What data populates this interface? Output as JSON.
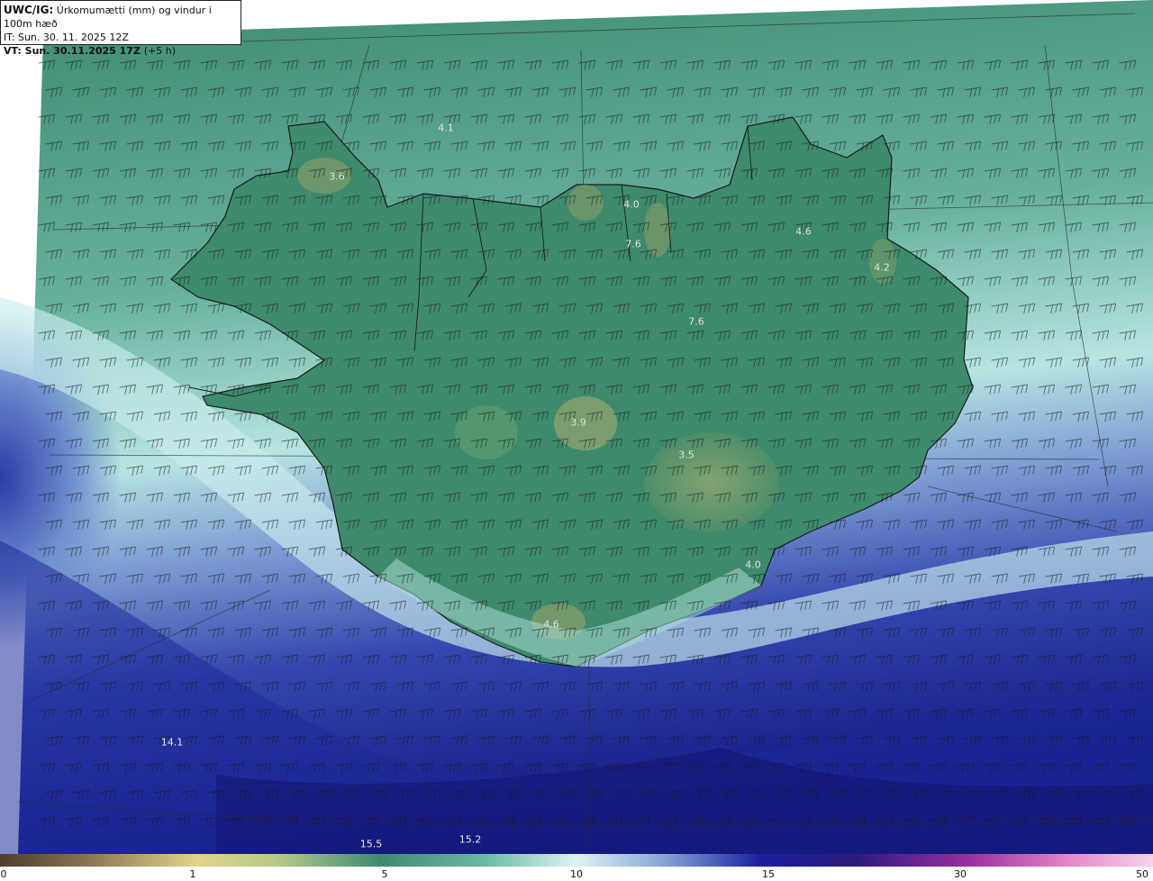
{
  "header": {
    "model": "UWC/IG:",
    "title": "Úrkomumætti (mm) og vindur i 100m hæð",
    "init_time": "IT: Sun. 30. 11. 2025 12Z",
    "valid_time": "VT: Sun. 30.11.2025 17Z",
    "lead": "(+5 h)"
  },
  "map_labels": [
    {
      "text": "4.1"
    },
    {
      "text": "3.6"
    },
    {
      "text": "4.0"
    },
    {
      "text": "7.6"
    },
    {
      "text": "4.6"
    },
    {
      "text": "4.2"
    },
    {
      "text": "7.6"
    },
    {
      "text": "3.9"
    },
    {
      "text": "3.5"
    },
    {
      "text": "4.0"
    },
    {
      "text": "4.6"
    },
    {
      "text": "14.1"
    },
    {
      "text": "15.5"
    },
    {
      "text": "15.2"
    }
  ],
  "colorbar": {
    "ticks": [
      "0",
      "1",
      "5",
      "10",
      "15",
      "30",
      "50"
    ],
    "colors": [
      "#5b4a3a",
      "#a48b5e",
      "#e0d48a",
      "#6ba37e",
      "#3f8a72",
      "#cfeff0",
      "#7b9bd0",
      "#1a1fa0",
      "#16166e",
      "#6a1f8a",
      "#e27fc0",
      "#f2c4e4"
    ]
  },
  "colors": {
    "ocean_deep": "#1c2a9c",
    "ocean_mid": "#6c86c8",
    "ocean_light": "#cdeef0",
    "sea_teal": "#5fae98",
    "land": "#3f8a6e",
    "highland": "#7e9a6a",
    "coast": "#1a1a1a"
  }
}
